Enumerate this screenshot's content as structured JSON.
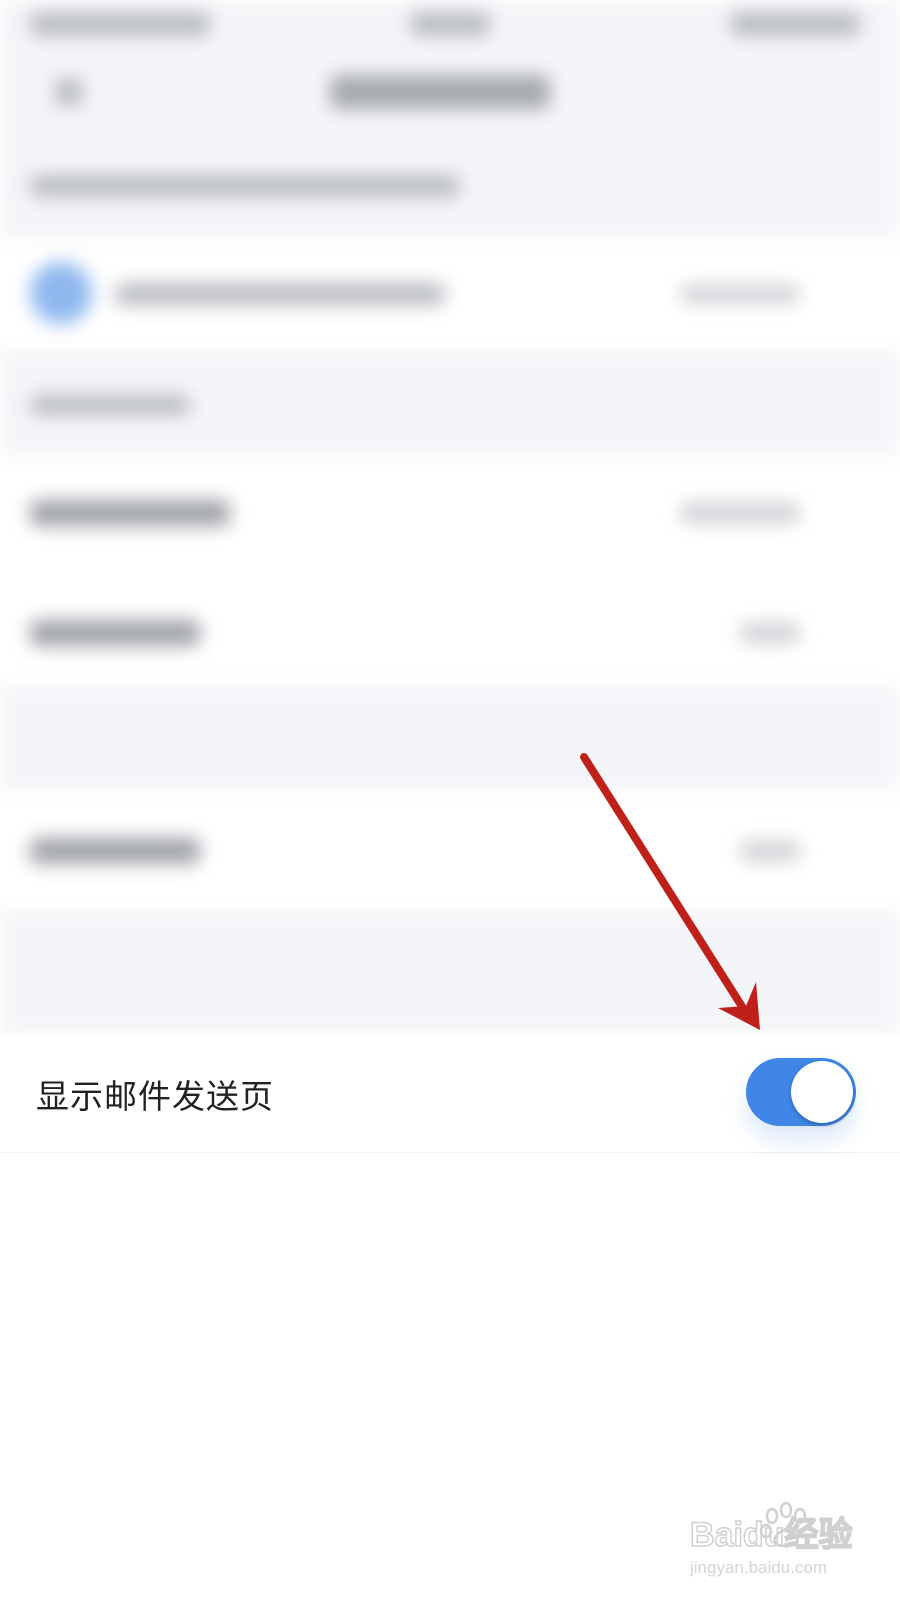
{
  "setting": {
    "label": "显示邮件发送页",
    "toggle_on": true
  },
  "colors": {
    "toggle_accent": "#3f86e6",
    "arrow": "#c0201a",
    "background_blur": "#f4f5f8"
  },
  "watermark": {
    "brand": "Baidu经验",
    "url": "jingyan.baidu.com"
  }
}
